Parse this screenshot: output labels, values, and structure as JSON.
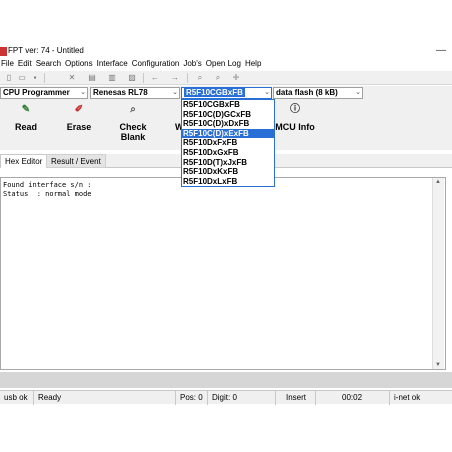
{
  "window": {
    "title": "FPT ver: 74 - Untitled"
  },
  "menu": [
    "File",
    "Edit",
    "Search",
    "Options",
    "Interface",
    "Configuration",
    "Job's",
    "Open Log",
    "Help"
  ],
  "selectors": {
    "programmer": "CPU Programmer",
    "family": "Renesas RL78",
    "device": "R5F10CGBxFB",
    "flash": "data flash (8 kB)"
  },
  "device_options": [
    "R5F10CGBxFB",
    "R5F10C(D)GCxFB",
    "R5F10C(D)xDxFB",
    "R5F10C(D)xExFB",
    "R5F10DxFxFB",
    "R5F10DxGxFB",
    "R5F10D(T)xJxFB",
    "R5F10DxKxFB",
    "R5F10DxLxFB"
  ],
  "device_highlighted_index": 3,
  "actions": {
    "read": "Read",
    "erase": "Erase",
    "check_blank": "Check Blank",
    "write_partial": "W",
    "mcu_info": "MCU Info"
  },
  "tabs": {
    "hex_editor": "Hex Editor",
    "result_event": "Result / Event"
  },
  "log": [
    "Found interface s/n :",
    "Status  : normal mode"
  ],
  "status": {
    "usb": "usb ok",
    "state": "Ready",
    "pos": "Pos: 0",
    "digit": "Digit: 0",
    "mode": "Insert",
    "time": "00:02",
    "inet": "i-net ok"
  }
}
